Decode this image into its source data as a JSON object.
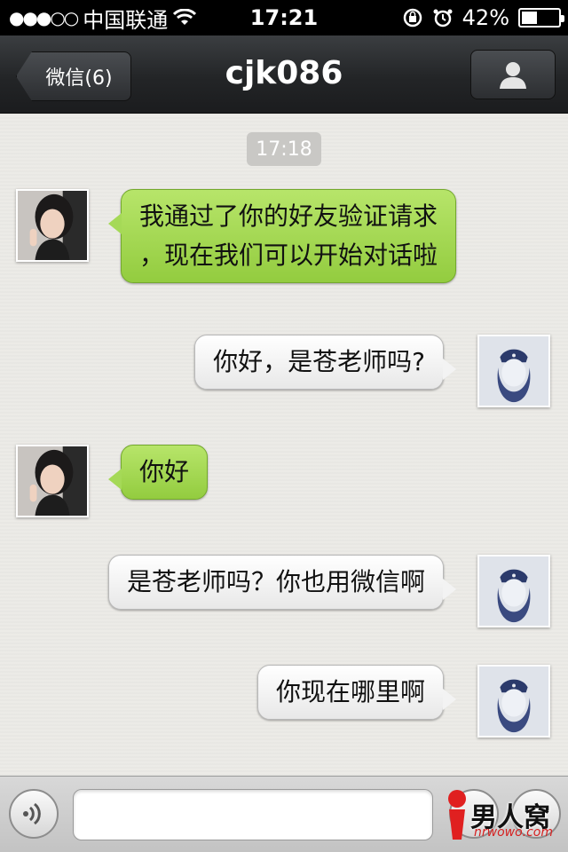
{
  "status_bar": {
    "signal": "●●●○○",
    "carrier": "中国联通",
    "time": "17:21",
    "battery_percent": "42%",
    "battery_level": 0.42
  },
  "nav": {
    "back_label": "微信(6)",
    "title": "cjk086",
    "profile_icon": "person-icon"
  },
  "chat": {
    "timestamp": "17:18",
    "messages": [
      {
        "side": "left",
        "lines": [
          "我通过了你的好友验证请求",
          "，现在我们可以开始对话啦"
        ]
      },
      {
        "side": "right",
        "lines": [
          "你好，是苍老师吗?"
        ]
      },
      {
        "side": "left",
        "lines": [
          "你好"
        ]
      },
      {
        "side": "right",
        "lines": [
          "是苍老师吗？你也用微信啊"
        ]
      },
      {
        "side": "right",
        "lines": [
          "你现在哪里啊"
        ]
      }
    ]
  },
  "input_bar": {
    "voice_icon": "voice-icon",
    "input_value": "",
    "emoji_icon": "emoji-icon",
    "plus_icon": "plus-icon"
  },
  "watermark": {
    "logo_text": "男人窝",
    "url": "nrwowo.com"
  },
  "colors": {
    "left_bubble": "#a5d957",
    "right_bubble": "#f3f3f3",
    "nav_bg": "#232527"
  }
}
